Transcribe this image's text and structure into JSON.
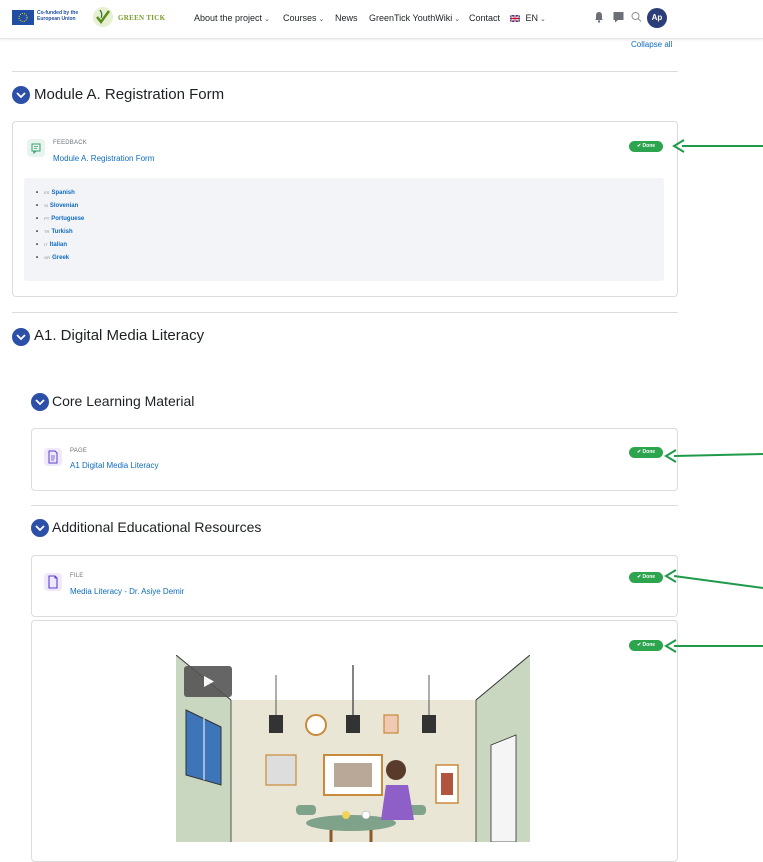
{
  "header": {
    "eu_label": "Co-funded by the European Union",
    "brand_label": "GREEN TICK",
    "nav": [
      {
        "label": "About the project",
        "dropdown": true
      },
      {
        "label": "Courses",
        "dropdown": true
      },
      {
        "label": "News",
        "dropdown": false
      },
      {
        "label": "GreenTick YouthWiki",
        "dropdown": true
      },
      {
        "label": "Contact",
        "dropdown": false
      }
    ],
    "language": {
      "label": "EN",
      "flag": "uk-flag-icon"
    },
    "icons": [
      "bell-icon",
      "chat-icon",
      "search-icon"
    ],
    "avatar_initials": "Ap"
  },
  "collapse_all": "Collapse all",
  "sections": {
    "module_a": {
      "title": "Module A. Registration Form",
      "activity": {
        "type": "FEEDBACK",
        "name": "Module A. Registration Form",
        "status": "Done"
      },
      "languages": [
        {
          "code": "ES",
          "label": "Spanish"
        },
        {
          "code": "SI",
          "label": "Slovenian"
        },
        {
          "code": "PT",
          "label": "Portuguese"
        },
        {
          "code": "TR",
          "label": "Turkish"
        },
        {
          "code": "IT",
          "label": "Italian"
        },
        {
          "code": "GR",
          "label": "Greek"
        }
      ]
    },
    "a1": {
      "title": "A1. Digital Media Literacy",
      "core": {
        "title": "Core Learning Material",
        "activity": {
          "type": "PAGE",
          "name": "A1 Digital Media Literacy",
          "status": "Done"
        }
      },
      "additional": {
        "title": "Additional Educational Resources",
        "file": {
          "type": "FILE",
          "name": "Media Literacy - Dr. Asiye Demir",
          "status": "Done"
        },
        "video_status": "Done"
      }
    }
  },
  "colors": {
    "toggle": "#2c4fa8",
    "link": "#0f6cbf",
    "done": "#2da44e",
    "arrow": "#1f9a4a"
  }
}
